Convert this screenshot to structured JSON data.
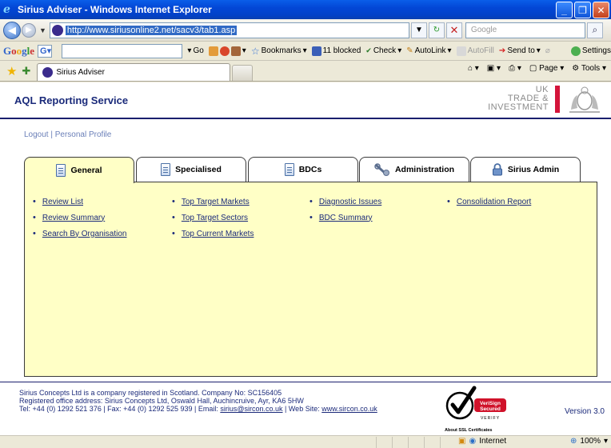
{
  "window": {
    "title": "Sirius Adviser - Windows Internet Explorer",
    "url": "http://www.siriusonline2.net/sacv3/tab1.asp",
    "search_placeholder": "Google"
  },
  "google_toolbar": {
    "go_label": "Go",
    "bookmarks_label": "Bookmarks",
    "blocked_label": "11 blocked",
    "check_label": "Check",
    "autolink_label": "AutoLink",
    "autofill_label": "AutoFill",
    "sendto_label": "Send to",
    "settings_label": "Settings"
  },
  "browser_tabs": [
    {
      "label": "Sirius Adviser"
    }
  ],
  "command_bar": {
    "page_label": "Page",
    "tools_label": "Tools"
  },
  "app": {
    "title": "AQL Reporting Service",
    "logo_lines": [
      "UK",
      "TRADE &",
      "INVESTMENT"
    ],
    "logout_label": "Logout",
    "separator": " | ",
    "profile_label": "Personal Profile"
  },
  "tabs": [
    {
      "label": "General",
      "icon": "document-icon",
      "active": true
    },
    {
      "label": "Specialised",
      "icon": "document-icon",
      "active": false
    },
    {
      "label": "BDCs",
      "icon": "document-icon",
      "active": false
    },
    {
      "label": "Administration",
      "icon": "wrench-icon",
      "active": false
    },
    {
      "label": "Sirius Admin",
      "icon": "lock-icon",
      "active": false
    }
  ],
  "menu_columns": [
    [
      "Review List",
      "Review Summary",
      "Search By Organisation"
    ],
    [
      "Top Target Markets",
      "Top Target Sectors",
      "Top Current Markets"
    ],
    [
      "Diagnostic Issues",
      "BDC Summary"
    ],
    [
      "Consolidation Report"
    ]
  ],
  "footer": {
    "line1": "Sirius Concepts Ltd is a company registered in Scotland. Company No: SC156405",
    "line2": "Registered office address: Sirius Concepts Ltd, Oswald Hall, Auchincruive, Ayr, KA6 5HW",
    "line3_prefix": "Tel: +44 (0) 1292 521 376 | Fax: +44 (0) 1292 525 939 | Email: ",
    "email": "sirius@sircon.co.uk",
    "line3_mid": " | Web Site: ",
    "website": "www.sircon.co.uk",
    "badge_line1": "VeriSign",
    "badge_line2": "Secured",
    "badge_verify": "VERIFY",
    "badge_caption": "About SSL Certificates",
    "version": "Version 3.0"
  },
  "status": {
    "zone": "Internet",
    "zoom": "100%"
  }
}
